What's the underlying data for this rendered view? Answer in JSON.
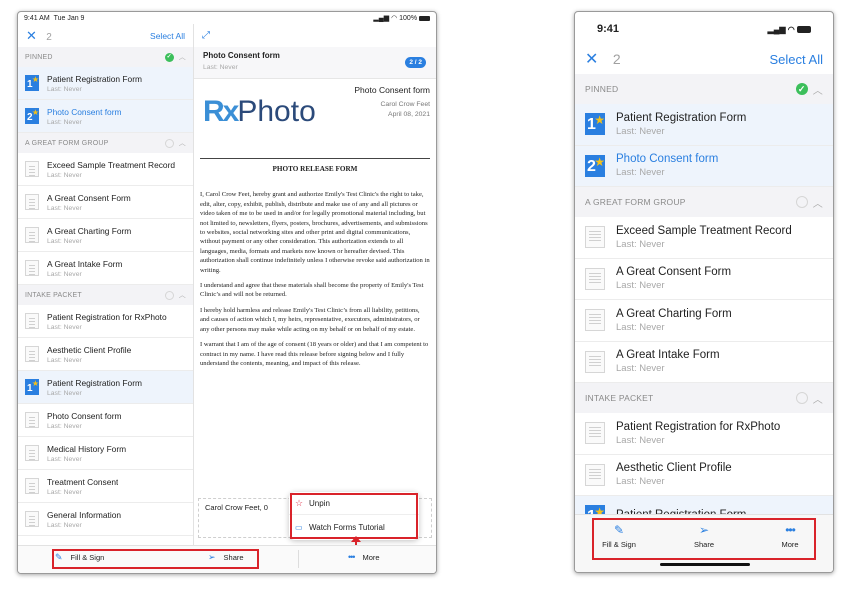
{
  "ipad": {
    "status": {
      "time": "9:41 AM",
      "date": "Tue Jan 9",
      "battery": "100%"
    },
    "header": {
      "count": "2",
      "select_all": "Select All"
    },
    "sections": [
      {
        "title": "PINNED",
        "state": "checked",
        "items": [
          {
            "title": "Patient Registration Form",
            "sub": "Last: Never",
            "thumb": "blue",
            "num": "1",
            "selected": true
          },
          {
            "title": "Photo Consent form",
            "sub": "Last: Never",
            "thumb": "blue",
            "num": "2",
            "selected": true,
            "active": true
          }
        ]
      },
      {
        "title": "A GREAT FORM GROUP",
        "state": "empty",
        "items": [
          {
            "title": "Exceed Sample Treatment Record",
            "sub": "Last: Never"
          },
          {
            "title": "A Great Consent Form",
            "sub": "Last: Never"
          },
          {
            "title": "A Great Charting Form",
            "sub": "Last: Never"
          },
          {
            "title": "A Great Intake Form",
            "sub": "Last: Never"
          }
        ]
      },
      {
        "title": "INTAKE PACKET",
        "state": "empty",
        "items": [
          {
            "title": "Patient Registration for RxPhoto",
            "sub": "Last: Never"
          },
          {
            "title": "Aesthetic Client Profile",
            "sub": "Last: Never"
          },
          {
            "title": "Patient Registration Form",
            "sub": "Last: Never",
            "thumb": "blue",
            "num": "1",
            "selected": true
          },
          {
            "title": "Photo Consent form",
            "sub": "Last: Never"
          },
          {
            "title": "Medical History Form",
            "sub": "Last: Never"
          },
          {
            "title": "Treatment Consent",
            "sub": "Last: Never"
          },
          {
            "title": "General Information",
            "sub": "Last: Never"
          }
        ]
      }
    ],
    "detail": {
      "title": "Photo Consent form",
      "sub": "Last: Never",
      "page_badge": "2 / 2",
      "logo_rx": "Rx",
      "logo_photo": "Photo",
      "doc_title": "Photo Consent form",
      "doc_name": "Carol Crow Feet",
      "doc_date": "April 08, 2021",
      "release_heading": "PHOTO RELEASE FORM",
      "paragraphs": [
        "I, Carol Crow Feet, hereby grant and authorize Emily's Test Clinic's the right to take, edit, alter, copy, exhibit, publish, distribute and make use of any and all pictures or video taken of me to be used in and/or for legally promotional material including, but not limited to, newsletters, flyers, posters, brochures, advertisements, and submissions to websites, social networking sites and other print and digital communications, without payment or any other consideration. This authorization extends to all languages, media, formats and markets now known or hereafter devised.  This authorization shall continue indefinitely unless I otherwise revoke said authorization in writing.",
        "I understand and agree that these materials shall become the property of Emily's Test Clinic’s and will not be returned.",
        "I hereby hold harmless and release Emily's Test Clinic’s from all liability, petitions, and causes of action which I, my heirs, representative, executors, administrators, or any other persons may make while acting on my behalf or on behalf of my estate.",
        "I warrant that I am of the age of consent (18 years or older) and that I am competent to contract in my name.  I have read this release before signing below and I fully understand the contents, meaning, and impact of this release."
      ],
      "signature_name": "Carol Crow Feet, 0"
    },
    "menu": {
      "unpin": "Unpin",
      "watch": "Watch Forms Tutorial"
    },
    "toolbar": {
      "fill_sign": "Fill & Sign",
      "share": "Share",
      "more": "More"
    }
  },
  "iphone": {
    "status": {
      "time": "9:41"
    },
    "header": {
      "count": "2",
      "select_all": "Select All"
    },
    "sections": [
      {
        "title": "PINNED",
        "state": "checked",
        "items": [
          {
            "title": "Patient Registration Form",
            "sub": "Last: Never",
            "thumb": "blue",
            "num": "1",
            "selected": true
          },
          {
            "title": "Photo Consent form",
            "sub": "Last: Never",
            "thumb": "blue",
            "num": "2",
            "selected": true,
            "active": true
          }
        ]
      },
      {
        "title": "A GREAT FORM GROUP",
        "state": "empty",
        "items": [
          {
            "title": "Exceed Sample Treatment Record",
            "sub": "Last: Never"
          },
          {
            "title": "A Great Consent Form",
            "sub": "Last: Never"
          },
          {
            "title": "A Great Charting Form",
            "sub": "Last: Never"
          },
          {
            "title": "A Great Intake Form",
            "sub": "Last: Never"
          }
        ]
      },
      {
        "title": "INTAKE PACKET",
        "state": "empty",
        "items": [
          {
            "title": "Patient Registration for RxPhoto",
            "sub": "Last: Never"
          },
          {
            "title": "Aesthetic Client Profile",
            "sub": "Last: Never"
          },
          {
            "title": "Patient Registration Form",
            "sub": "",
            "thumb": "blue",
            "num": "1",
            "selected": true
          }
        ]
      }
    ],
    "toolbar": {
      "fill_sign": "Fill & Sign",
      "share": "Share",
      "more": "More"
    }
  },
  "colors": {
    "accent": "#2a7fe0",
    "highlight": "#d9232a",
    "check": "#3cbf5b",
    "star": "#f3c019"
  }
}
